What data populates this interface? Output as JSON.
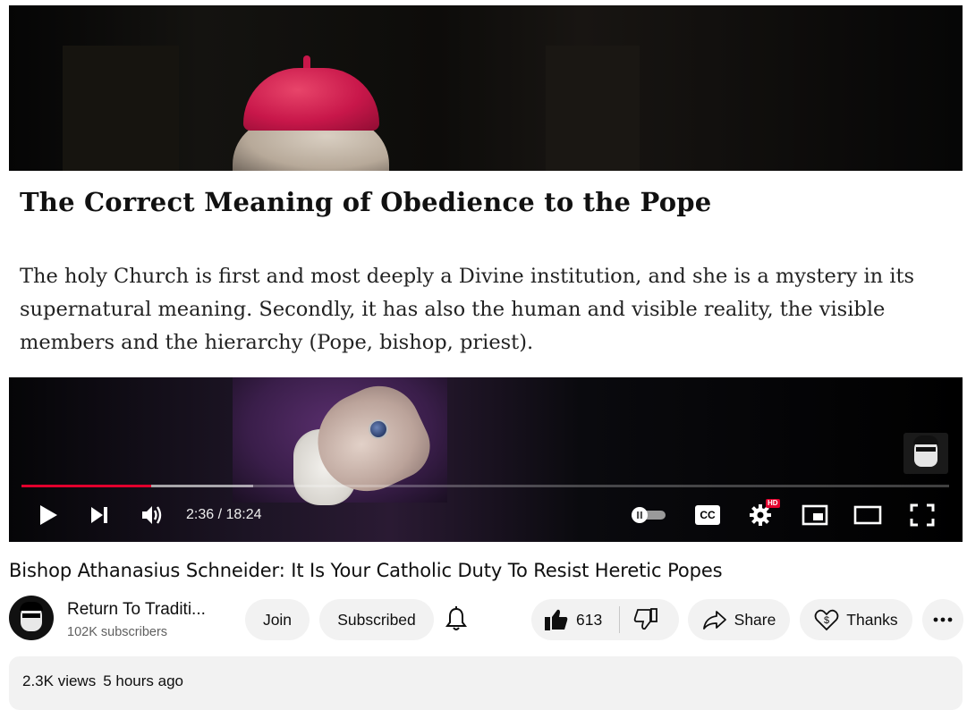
{
  "video": {
    "overlay_title": "The Correct Meaning of Obedience to the Pope",
    "overlay_body": "The holy Church is first and most deeply a Divine institution, and she is a mystery in its supernatural meaning. Secondly, it has also the human and visible reality, the visible members and the hierarchy (Pope, bishop, priest).",
    "played_fraction": 0.14,
    "buffered_fraction": 0.25
  },
  "controls": {
    "time": "2:36 / 18:24",
    "play_icon": "play-icon",
    "next_icon": "next-icon",
    "volume_icon": "volume-icon",
    "autoplay_icon": "autoplay-toggle-icon",
    "cc_label": "CC",
    "settings_badge": "HD",
    "miniplayer_icon": "miniplayer-icon",
    "theater_icon": "theater-icon",
    "fullscreen_icon": "fullscreen-icon",
    "accent": "#e1002d"
  },
  "info": {
    "title": "Bishop Athanasius Schneider: It Is Your Catholic Duty To Resist Heretic Popes",
    "channel_name": "Return To Traditi...",
    "subscribers": "102K subscribers",
    "join_label": "Join",
    "subscribed_label": "Subscribed",
    "like_count": "613",
    "share_label": "Share",
    "thanks_label": "Thanks"
  },
  "description": {
    "views": "2.3K views",
    "age": "5 hours ago"
  }
}
